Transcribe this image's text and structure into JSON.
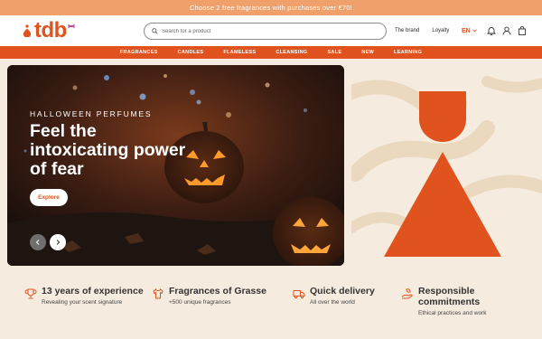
{
  "promo": {
    "text": "Choose 2 free fragrances with purchases over €70!"
  },
  "header": {
    "logo_text": "tdb",
    "search_placeholder": "Search for a product",
    "links": [
      "The brand",
      "Loyalty"
    ],
    "language": "EN"
  },
  "nav": {
    "items": [
      "FRAGRANCES",
      "CANDLES",
      "FLAMELESS",
      "CLEANSING",
      "SALE",
      "NEW",
      "LEARNING"
    ]
  },
  "hero": {
    "eyebrow": "HALLOWEEN PERFUMES",
    "title": "Feel the intoxicating power of fear",
    "button_label": "Explore"
  },
  "features": [
    {
      "icon": "trophy-icon",
      "title": "13 years of experience",
      "subtitle": "Revealing your scent signature"
    },
    {
      "icon": "shirt-icon",
      "title": "Fragrances of Grasse",
      "subtitle": "+500 unique fragrances"
    },
    {
      "icon": "truck-icon",
      "title": "Quick delivery",
      "subtitle": "All over the world"
    },
    {
      "icon": "hand-leaf-icon",
      "title": "Responsible commitments",
      "subtitle": "Ethical practices and work"
    }
  ],
  "colors": {
    "brand": "#e0531e",
    "promo": "#f0a06a",
    "background": "#f5ecdf"
  }
}
